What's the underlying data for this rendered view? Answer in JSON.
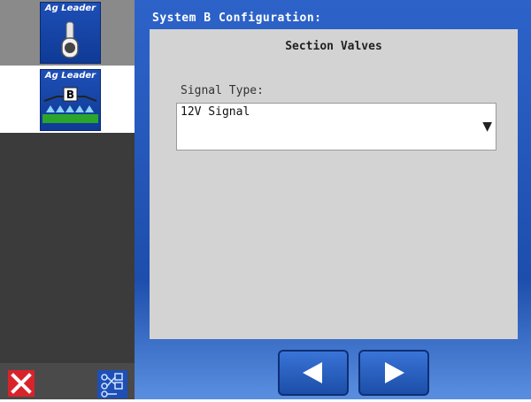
{
  "sidebar": {
    "tiles": [
      {
        "brand": "Ag Leader",
        "icon": "toggle-switch-icon",
        "selected": false
      },
      {
        "brand": "Ag Leader",
        "icon": "boom-b-icon",
        "badge": "B",
        "selected": true
      }
    ],
    "bottom": {
      "close_icon": "close-icon",
      "map_icon": "system-diagram-icon"
    }
  },
  "main": {
    "title": "System B Configuration:",
    "panel": {
      "heading": "Section Valves",
      "field_label": "Signal Type:",
      "select_value": "12V Signal",
      "caret": "▼"
    },
    "nav": {
      "back_icon": "arrow-left-icon",
      "next_icon": "arrow-right-icon"
    }
  },
  "colors": {
    "accent": "#1e4fb6",
    "panel": "#d3d3d3",
    "sidebar": "#3b3b3b",
    "close": "#d8232a"
  }
}
